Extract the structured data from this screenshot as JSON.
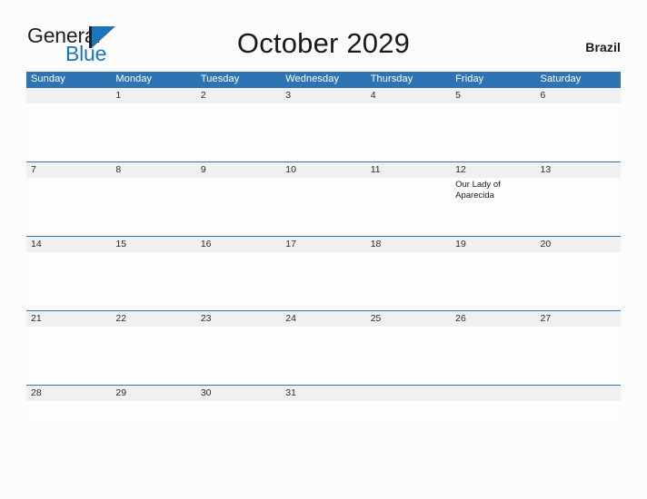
{
  "brand": {
    "word1": "General",
    "word2": "Blue",
    "flag_icon": "blue-flag-triangle",
    "accent_color": "#1b75bb"
  },
  "header": {
    "title": "October 2029",
    "country": "Brazil"
  },
  "theme": {
    "header_blue": "#2e74b5",
    "number_band_gray": "#f0f0f0",
    "page_background": "#fcfcfc",
    "text_dark": "#1a1a1a"
  },
  "calendar": {
    "weekday_headers": [
      "Sunday",
      "Monday",
      "Tuesday",
      "Wednesday",
      "Thursday",
      "Friday",
      "Saturday"
    ],
    "weeks": [
      [
        {
          "day": "",
          "events": []
        },
        {
          "day": "1",
          "events": []
        },
        {
          "day": "2",
          "events": []
        },
        {
          "day": "3",
          "events": []
        },
        {
          "day": "4",
          "events": []
        },
        {
          "day": "5",
          "events": []
        },
        {
          "day": "6",
          "events": []
        }
      ],
      [
        {
          "day": "7",
          "events": []
        },
        {
          "day": "8",
          "events": []
        },
        {
          "day": "9",
          "events": []
        },
        {
          "day": "10",
          "events": []
        },
        {
          "day": "11",
          "events": []
        },
        {
          "day": "12",
          "events": [
            "Our Lady of Aparecida"
          ]
        },
        {
          "day": "13",
          "events": []
        }
      ],
      [
        {
          "day": "14",
          "events": []
        },
        {
          "day": "15",
          "events": []
        },
        {
          "day": "16",
          "events": []
        },
        {
          "day": "17",
          "events": []
        },
        {
          "day": "18",
          "events": []
        },
        {
          "day": "19",
          "events": []
        },
        {
          "day": "20",
          "events": []
        }
      ],
      [
        {
          "day": "21",
          "events": []
        },
        {
          "day": "22",
          "events": []
        },
        {
          "day": "23",
          "events": []
        },
        {
          "day": "24",
          "events": []
        },
        {
          "day": "25",
          "events": []
        },
        {
          "day": "26",
          "events": []
        },
        {
          "day": "27",
          "events": []
        }
      ],
      [
        {
          "day": "28",
          "events": []
        },
        {
          "day": "29",
          "events": []
        },
        {
          "day": "30",
          "events": []
        },
        {
          "day": "31",
          "events": []
        },
        {
          "day": "",
          "events": []
        },
        {
          "day": "",
          "events": []
        },
        {
          "day": "",
          "events": []
        }
      ]
    ]
  }
}
